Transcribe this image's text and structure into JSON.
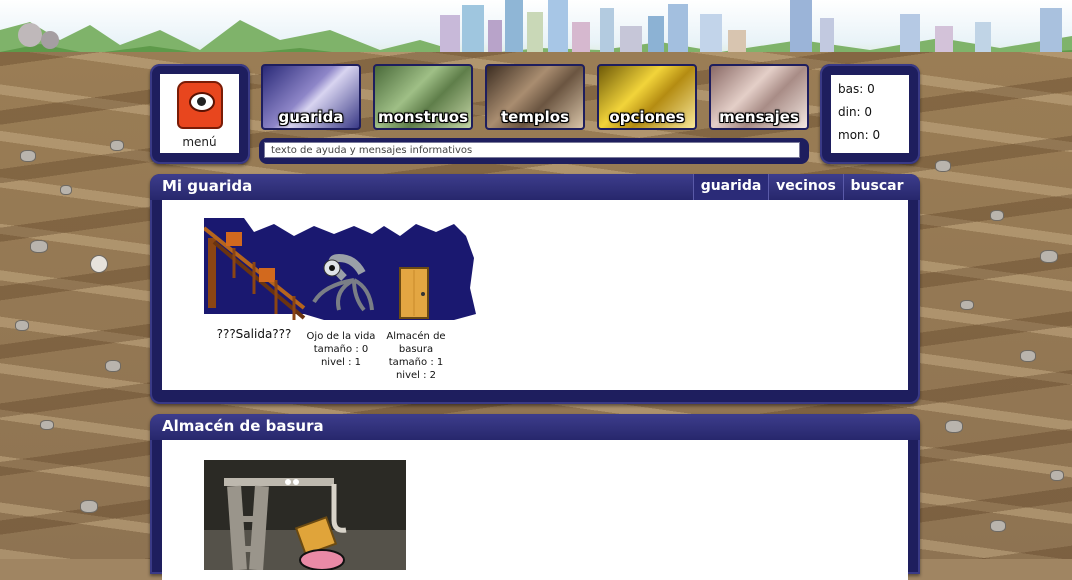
{
  "menu": {
    "label": "menú"
  },
  "nav": [
    {
      "id": "guarida",
      "label": "guarida"
    },
    {
      "id": "monstruos",
      "label": "monstruos"
    },
    {
      "id": "templos",
      "label": "templos"
    },
    {
      "id": "opciones",
      "label": "opciones"
    },
    {
      "id": "mensajes",
      "label": "mensajes"
    }
  ],
  "help": {
    "text": "texto de ayuda y mensajes informativos"
  },
  "stats": {
    "bas": "bas: 0",
    "din": "din: 0",
    "mon": "mon: 0"
  },
  "lair_panel": {
    "title": "Mi guarida",
    "tabs": [
      {
        "label": "guarida",
        "active": true
      },
      {
        "label": "vecinos",
        "active": false
      },
      {
        "label": "buscar",
        "active": false
      }
    ],
    "rooms": [
      {
        "name": "???Salida???",
        "size": "",
        "level": ""
      },
      {
        "name": "Ojo de la vida",
        "size": "tamaño : 0",
        "level": "nivel : 1"
      },
      {
        "name": "Almacén de",
        "name2": "basura",
        "size": "tamaño : 1",
        "level": "nivel : 2"
      }
    ]
  },
  "detail_panel": {
    "title": "Almacén de basura"
  },
  "colors": {
    "panel": "#1e1e5e",
    "panel_header": "#3d3d8c",
    "monster": "#e8461e"
  }
}
